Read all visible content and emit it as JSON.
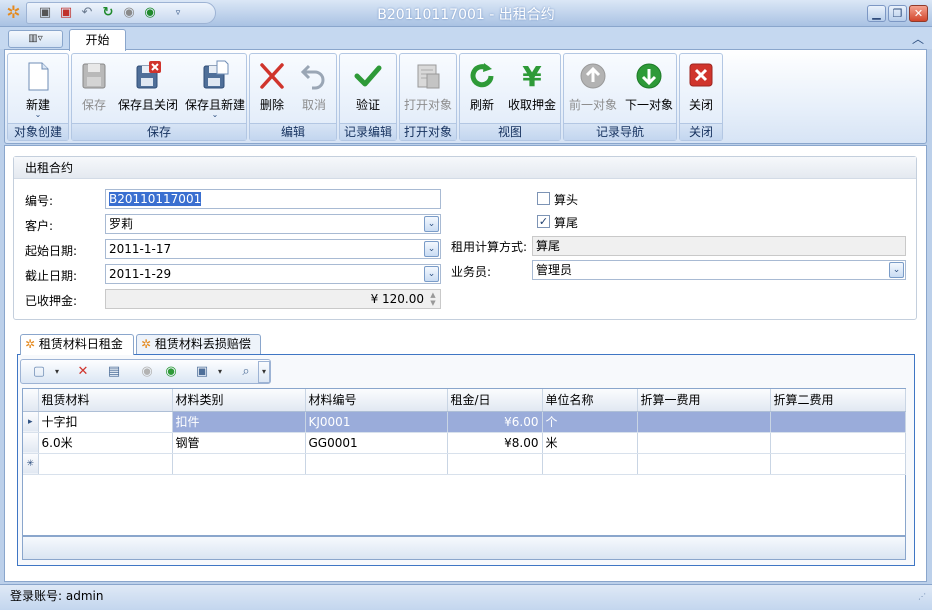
{
  "window": {
    "title": "B20110117001 - 出租合约",
    "minimize": "▁",
    "restore": "❐",
    "close": "✕"
  },
  "qat": {
    "items": [
      "save-icon",
      "save-close-icon",
      "undo-icon",
      "refresh-icon",
      "prev-icon",
      "next-icon",
      "customize-icon"
    ]
  },
  "tabs": {
    "menu": "▥▿",
    "start": "开始",
    "collapse": "︿"
  },
  "ribbon": {
    "groups": [
      {
        "label": "对象创建"
      },
      {
        "label": "保存"
      },
      {
        "label": "编辑"
      },
      {
        "label": "记录编辑"
      },
      {
        "label": "打开对象"
      },
      {
        "label": "视图"
      },
      {
        "label": "记录导航"
      },
      {
        "label": "关闭"
      }
    ],
    "buttons": {
      "new": "新建",
      "save": "保存",
      "save_close": "保存且关闭",
      "save_new": "保存且新建",
      "delete": "删除",
      "cancel": "取消",
      "validate": "验证",
      "open_object": "打开对象",
      "refresh": "刷新",
      "collect_deposit": "收取押金",
      "prev_object": "前一对象",
      "next_object": "下一对象",
      "close": "关闭"
    },
    "dropdown_glyph": "⌄"
  },
  "form": {
    "panel_title": "出租合约",
    "labels": {
      "number": "编号:",
      "customer": "客户:",
      "start_date": "起始日期:",
      "end_date": "截止日期:",
      "deposit": "已收押金:",
      "count_head": "算头",
      "count_tail": "算尾",
      "rent_method": "租用计算方式:",
      "salesman": "业务员:"
    },
    "values": {
      "number": "B20110117001",
      "customer": "罗莉",
      "start_date": "2011-1-17",
      "end_date": "2011-1-29",
      "deposit": "¥ 120.00",
      "count_head_checked": false,
      "count_tail_checked": true,
      "count_tail_mark": "✓",
      "rent_method": "算尾",
      "salesman": "管理员"
    },
    "dropdown_glyph": "⌄"
  },
  "detail_tabs": [
    {
      "label": "租赁材料日租金",
      "icon": "gear-icon"
    },
    {
      "label": "租赁材料丢损赔偿",
      "icon": "gear-icon"
    }
  ],
  "grid": {
    "columns": [
      "租赁材料",
      "材料类别",
      "材料编号",
      "租金/日",
      "单位名称",
      "折算一费用",
      "折算二费用"
    ],
    "rows": [
      {
        "indicator": "▸",
        "material": "十字扣",
        "category": "扣件",
        "code": "KJ0001",
        "rent": "¥6.00",
        "unit": "个",
        "fee1": "",
        "fee2": ""
      },
      {
        "indicator": "",
        "material": "6.0米",
        "category": "钢管",
        "code": "GG0001",
        "rent": "¥8.00",
        "unit": "米",
        "fee1": "",
        "fee2": ""
      }
    ],
    "new_row_indicator": "✳"
  },
  "status": {
    "login": "登录账号: admin",
    "grip": "⋰"
  },
  "colors": {
    "ribbon_bg": "#dfeaf8",
    "selection": "#9aacda",
    "accent_blue": "#3f76c4"
  }
}
